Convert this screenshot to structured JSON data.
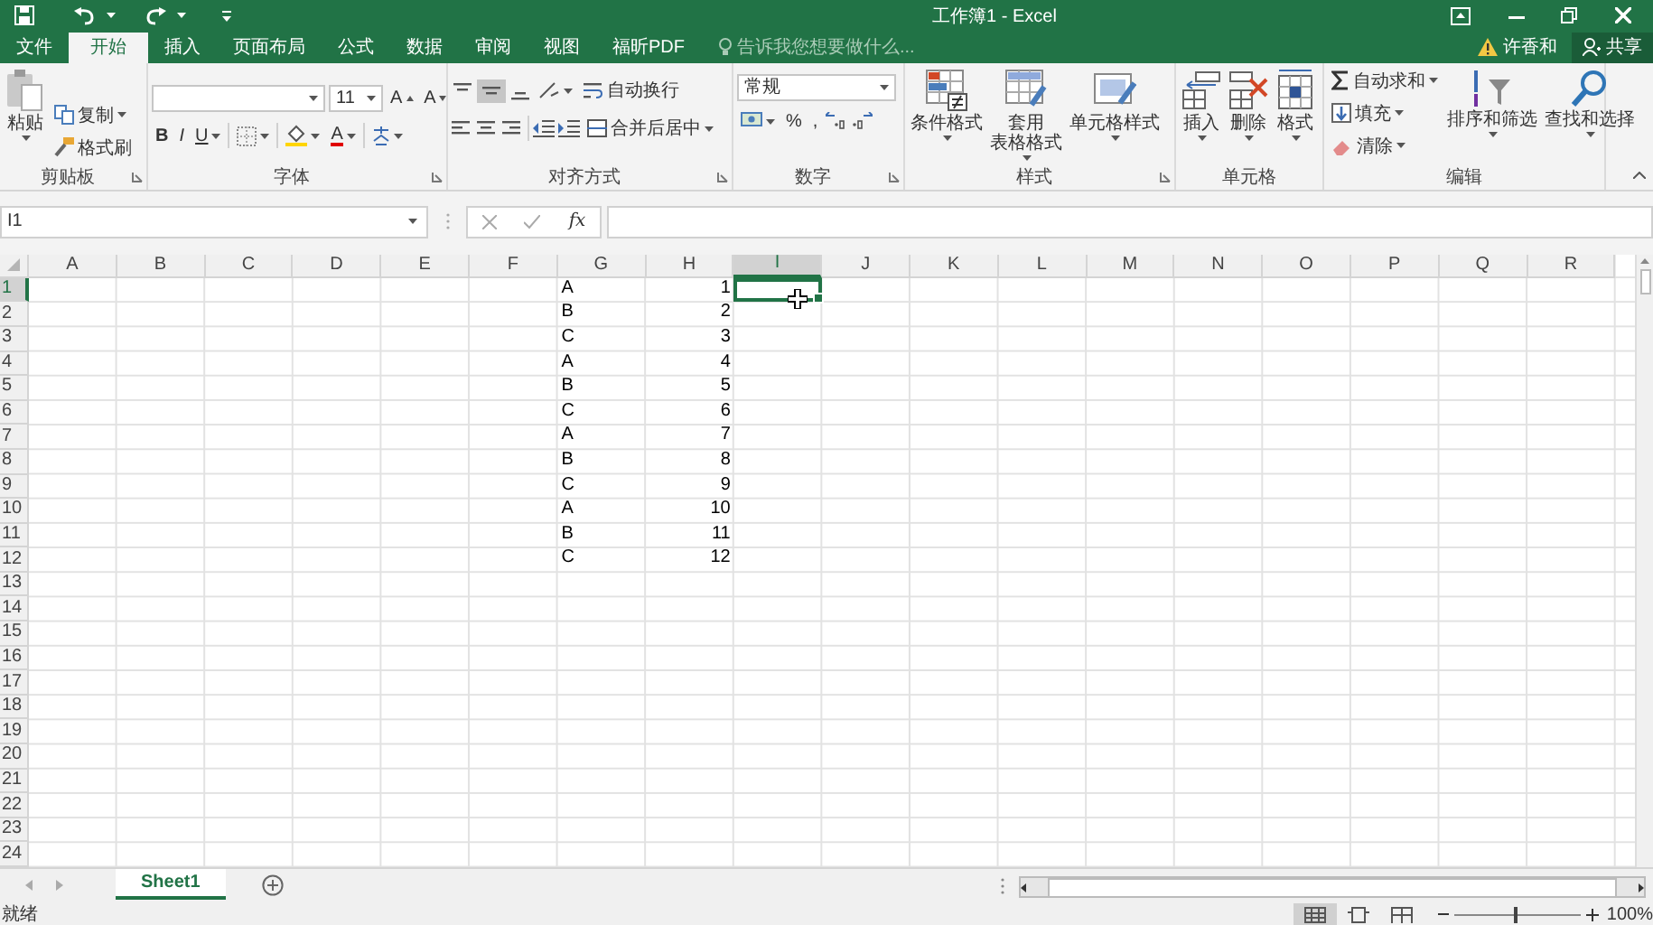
{
  "window": {
    "title": "工作簿1 - Excel"
  },
  "ribbon_tabs": [
    {
      "label": "文件",
      "selected": false
    },
    {
      "label": "开始",
      "selected": true
    },
    {
      "label": "插入",
      "selected": false
    },
    {
      "label": "页面布局",
      "selected": false
    },
    {
      "label": "公式",
      "selected": false
    },
    {
      "label": "数据",
      "selected": false
    },
    {
      "label": "审阅",
      "selected": false
    },
    {
      "label": "视图",
      "selected": false
    },
    {
      "label": "福昕PDF",
      "selected": false
    }
  ],
  "tell_me": {
    "placeholder": "告诉我您想要做什么..."
  },
  "account": {
    "user": "许香和",
    "share": "共享"
  },
  "ribbon": {
    "clipboard": {
      "label": "剪贴板",
      "paste": "粘贴",
      "copy": "复制",
      "format_painter": "格式刷"
    },
    "font": {
      "label": "字体",
      "size": "11",
      "grow": "A",
      "shrink": "A",
      "bold": "B",
      "italic": "I",
      "underline": "U",
      "font_color": "A"
    },
    "alignment": {
      "label": "对齐方式",
      "wrap_text": "自动换行",
      "merge_center": "合并后居中"
    },
    "number": {
      "label": "数字",
      "format": "常规",
      "percent": "%",
      "comma": ","
    },
    "styles": {
      "label": "样式",
      "conditional": "条件格式",
      "table_format": [
        "套用",
        "表格格式"
      ],
      "cell_styles": "单元格样式"
    },
    "cells": {
      "label": "单元格",
      "insert": "插入",
      "delete": "删除",
      "format": "格式"
    },
    "editing": {
      "label": "编辑",
      "autosum": "自动求和",
      "fill": "填充",
      "clear": "清除",
      "sort_filter": "排序和筛选",
      "find_select": "查找和选择"
    }
  },
  "formula_bar": {
    "name_box": "I1",
    "function_label": "fx"
  },
  "columns": [
    {
      "label": "A",
      "selected": false
    },
    {
      "label": "B",
      "selected": false
    },
    {
      "label": "C",
      "selected": false
    },
    {
      "label": "D",
      "selected": false
    },
    {
      "label": "E",
      "selected": false
    },
    {
      "label": "F",
      "selected": false
    },
    {
      "label": "G",
      "selected": false,
      "kind": "text",
      "cells": [
        "A",
        "B",
        "C",
        "A",
        "B",
        "C",
        "A",
        "B",
        "C",
        "A",
        "B",
        "C"
      ]
    },
    {
      "label": "H",
      "selected": false,
      "kind": "number",
      "cells": [
        "1",
        "2",
        "3",
        "4",
        "5",
        "6",
        "7",
        "8",
        "9",
        "10",
        "11",
        "12"
      ]
    },
    {
      "label": "I",
      "selected": true
    },
    {
      "label": "J",
      "selected": false
    },
    {
      "label": "K",
      "selected": false
    },
    {
      "label": "L",
      "selected": false
    },
    {
      "label": "M",
      "selected": false
    },
    {
      "label": "N",
      "selected": false
    },
    {
      "label": "O",
      "selected": false
    },
    {
      "label": "P",
      "selected": false
    },
    {
      "label": "Q",
      "selected": false
    },
    {
      "label": "R",
      "selected": false
    }
  ],
  "rows": [
    {
      "label": "1",
      "selected": true
    },
    {
      "label": "2",
      "selected": false
    },
    {
      "label": "3",
      "selected": false
    },
    {
      "label": "4",
      "selected": false
    },
    {
      "label": "5",
      "selected": false
    },
    {
      "label": "6",
      "selected": false
    },
    {
      "label": "7",
      "selected": false
    },
    {
      "label": "8",
      "selected": false
    },
    {
      "label": "9",
      "selected": false
    },
    {
      "label": "10",
      "selected": false
    },
    {
      "label": "11",
      "selected": false
    },
    {
      "label": "12",
      "selected": false
    },
    {
      "label": "13",
      "selected": false
    },
    {
      "label": "14",
      "selected": false
    },
    {
      "label": "15",
      "selected": false
    },
    {
      "label": "16",
      "selected": false
    },
    {
      "label": "17",
      "selected": false
    },
    {
      "label": "18",
      "selected": false
    },
    {
      "label": "19",
      "selected": false
    },
    {
      "label": "20",
      "selected": false
    },
    {
      "label": "21",
      "selected": false
    },
    {
      "label": "22",
      "selected": false
    },
    {
      "label": "23",
      "selected": false
    },
    {
      "label": "24",
      "selected": false
    }
  ],
  "sheet_tabs": [
    {
      "label": "Sheet1",
      "selected": true
    }
  ],
  "status_bar": {
    "status": "就绪",
    "views": [
      {
        "kind": "normal",
        "selected": true
      },
      {
        "kind": "page_layout",
        "selected": false
      },
      {
        "kind": "page_break",
        "selected": false
      }
    ],
    "zoom": {
      "level": 0.48
    },
    "zoom_text": "100%"
  }
}
